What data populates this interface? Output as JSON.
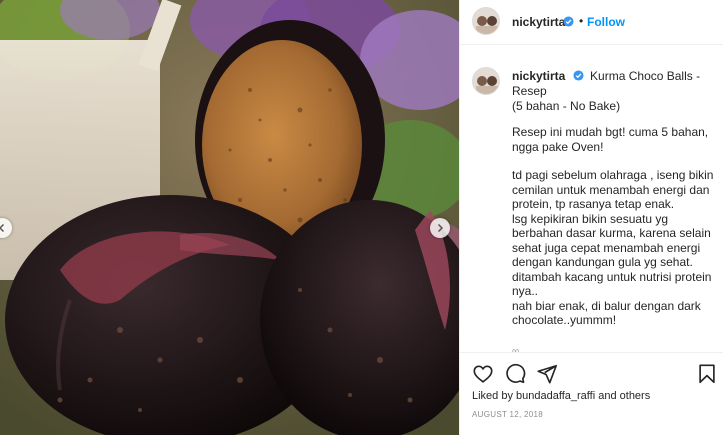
{
  "post": {
    "username": "nickytirta",
    "follow_label": "Follow",
    "dot_separator": "•",
    "verified_icon": "verified-badge-icon",
    "accent_color": "#0095f6"
  },
  "caption": {
    "username": "nickytirta",
    "title_line1": "Kurma Choco Balls -",
    "title_line2": "Resep",
    "title_line3": "(5 bahan - No Bake)",
    "para1": "Resep ini mudah bgt! cuma 5 bahan, ngga pake Oven!",
    "para2": "td pagi sebelum olahraga , iseng bikin cemilan untuk menambah energi dan protein, tp rasanya tetap enak.",
    "para3": "lsg kepikiran bikin sesuatu yg berbahan dasar kurma, karena selain sehat juga cepat menambah energi dengan kandungan gula yg sehat.",
    "para4": "ditambah kacang untuk nutrisi protein nya..",
    "para5": "nah biar enak, di balur dengan dark chocolate..yummm!",
    "more": "∞"
  },
  "actions": {
    "like_icon": "heart-icon",
    "comment_icon": "comment-icon",
    "share_icon": "share-icon",
    "save_icon": "bookmark-icon",
    "liked_by_prefix": "Liked by",
    "liked_by_user": "bundadaffa_raffi",
    "liked_by_suffix": "and others",
    "date": "AUGUST 12, 2018"
  },
  "photo": {
    "description_icon": "post-image",
    "prev_icon": "chevron-left-icon",
    "next_icon": "chevron-right-icon"
  }
}
